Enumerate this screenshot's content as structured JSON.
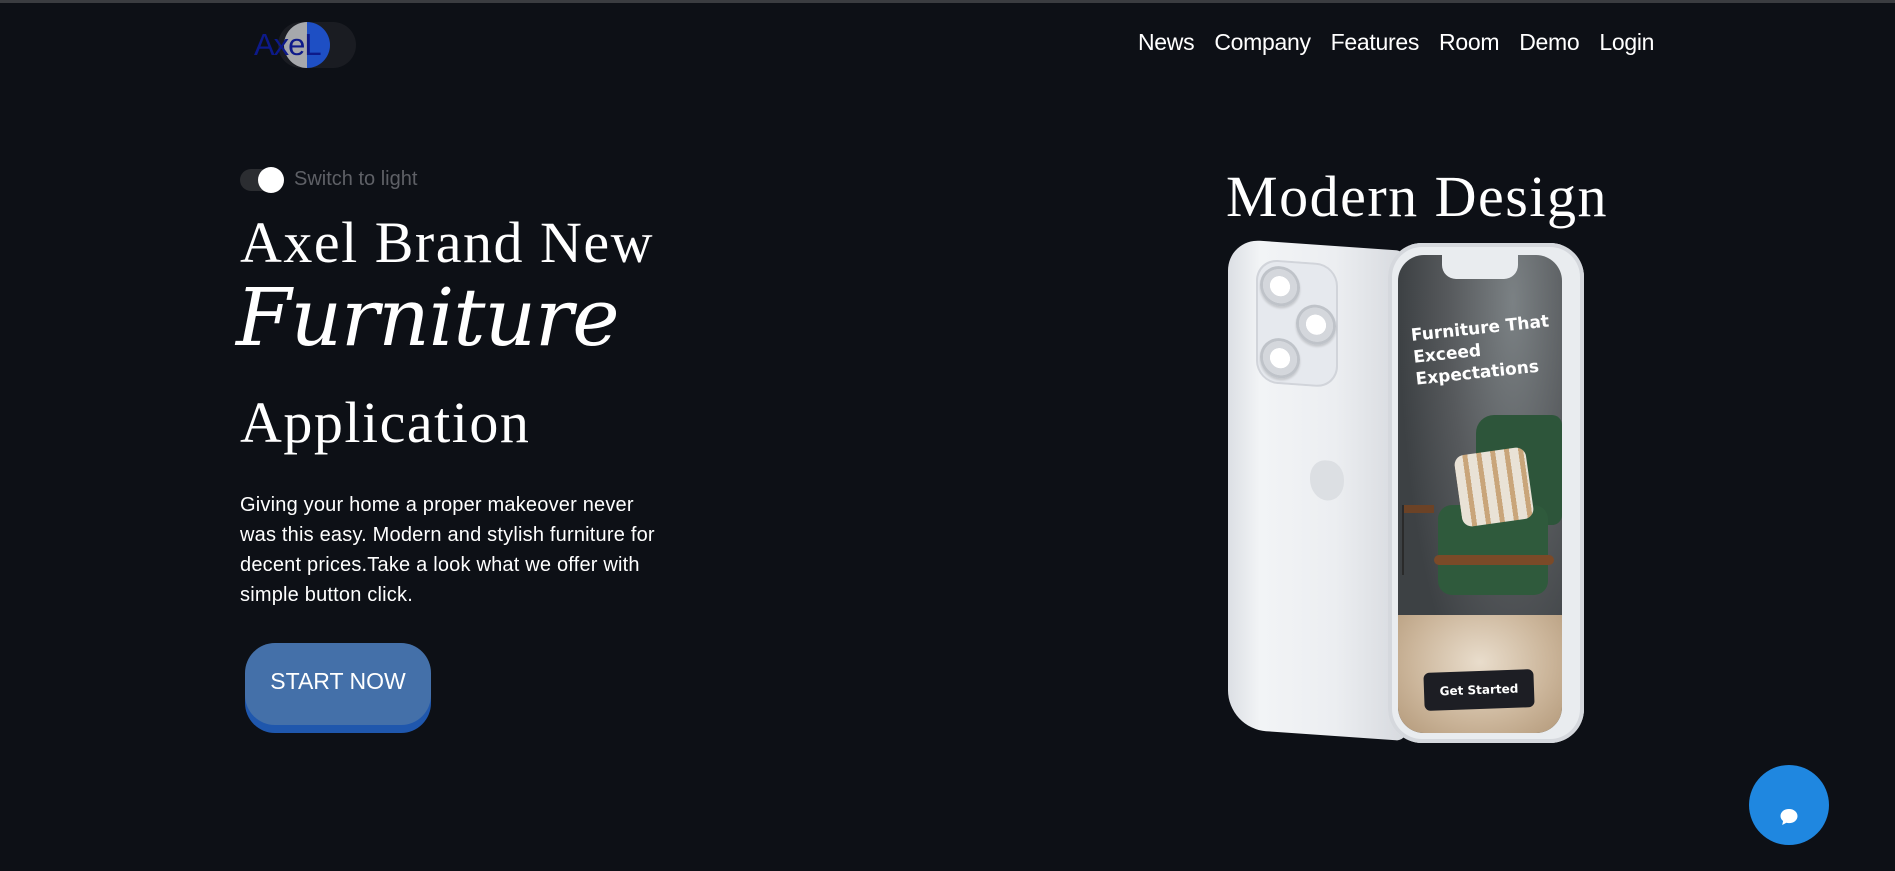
{
  "logo": {
    "text": "AxeL"
  },
  "nav": {
    "items": [
      {
        "label": "News"
      },
      {
        "label": "Company"
      },
      {
        "label": "Features"
      },
      {
        "label": "Room"
      },
      {
        "label": "Demo"
      },
      {
        "label": "Login"
      }
    ]
  },
  "theme_toggle": {
    "label": "Switch to light",
    "state": "dark"
  },
  "hero": {
    "line1": "Axel Brand New",
    "line2": "Furniture",
    "line3": "Application",
    "description": "Giving your home a proper makeover never was this easy. Modern and stylish furniture for decent prices.Take a look what we offer with simple button click.",
    "cta_label": "START NOW"
  },
  "showcase": {
    "title": "Modern Design",
    "screen_headline": "Furniture That Exceed Expectations",
    "screen_button": "Get Started"
  },
  "chat": {
    "icon": "chat-bubble-icon"
  },
  "colors": {
    "background": "#0d1016",
    "cta": "#4470a9",
    "cta_shadow": "#1f57ad",
    "chat": "#1f87e0",
    "logo_accent": "#1e4fc4"
  }
}
